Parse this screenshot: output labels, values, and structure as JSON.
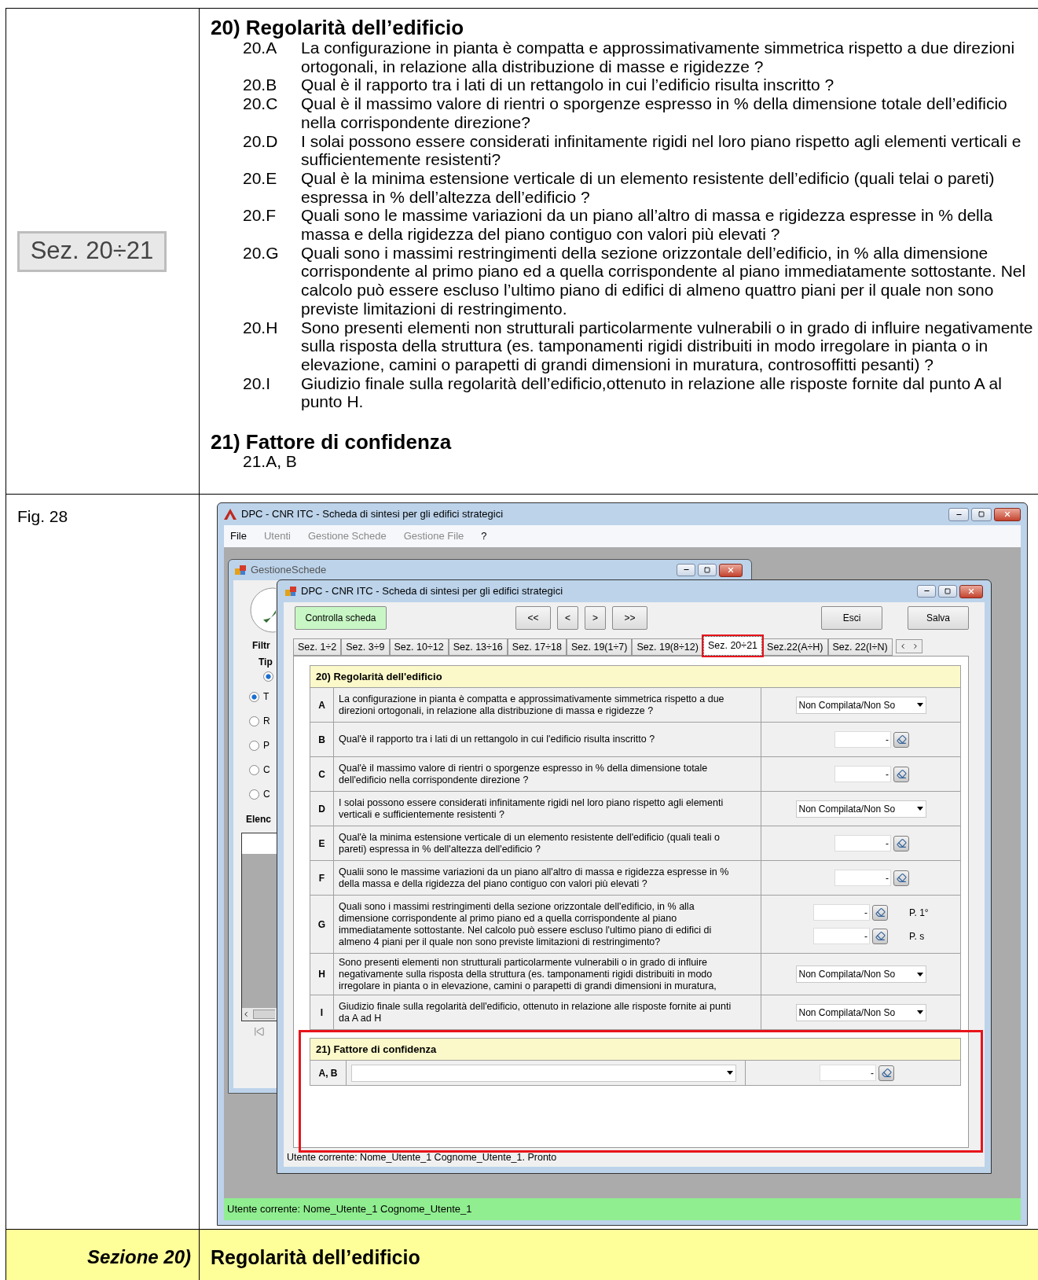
{
  "doc": {
    "top_left_image_label": "Sez. 20÷21",
    "section20": {
      "heading": "20) Regolarità dell’edificio",
      "items": [
        {
          "code": "20.A",
          "text": "La configurazione in pianta è compatta e approssimativamente simmetrica rispetto a due direzioni ortogonali, in relazione alla distribuzione di masse e rigidezze ?"
        },
        {
          "code": "20.B",
          "text": "Qual è il rapporto tra i lati di un rettangolo in cui l’edificio risulta inscritto ?"
        },
        {
          "code": "20.C",
          "text": "Qual è il massimo valore di rientri o sporgenze espresso in % della dimensione totale dell’edificio nella corrispondente direzione?"
        },
        {
          "code": "20.D",
          "text": "I solai possono essere considerati infinitamente rigidi nel loro piano rispetto agli elementi verticali e sufficientemente resistenti?"
        },
        {
          "code": "20.E",
          "text": "Qual è la minima estensione verticale di un elemento resistente dell’edificio (quali telai o pareti) espressa in % dell’altezza dell’edificio ?"
        },
        {
          "code": "20.F",
          "text": "Quali sono le massime variazioni da un piano all’altro di massa e rigidezza espresse in % della massa e della rigidezza del piano contiguo con valori più elevati ?"
        },
        {
          "code": "20.G",
          "text": "Quali sono i massimi restringimenti della sezione orizzontale dell’edificio, in % alla dimensione corrispondente al primo piano ed a quella corrispondente al piano immediatamente sottostante. Nel calcolo può essere escluso l’ultimo piano di edifici di almeno quattro piani per il quale non sono previste limitazioni di restringimento."
        },
        {
          "code": "20.H",
          "text": "Sono presenti elementi non strutturali particolarmente vulnerabili o in grado di influire negativamente sulla risposta della struttura (es. tamponamenti rigidi distribuiti in modo irregolare in pianta o in elevazione, camini o parapetti di grandi dimensioni in muratura, controsoffitti pesanti) ?"
        },
        {
          "code": "20.I",
          "text": "Giudizio finale sulla regolarità dell’edificio,ottenuto in relazione alle risposte fornite dal punto A al punto H."
        }
      ]
    },
    "section21": {
      "heading": "21) Fattore di confidenza",
      "items": [
        "21.A, B"
      ]
    },
    "figure_label": "Fig. 28",
    "footer": {
      "label": "Sezione 20)",
      "title": "Regolarità dell’edificio"
    }
  },
  "app": {
    "title": "DPC - CNR ITC - Scheda di sintesi per gli edifici strategici",
    "menu": [
      {
        "label": "File",
        "disabled": false
      },
      {
        "label": "Utenti",
        "disabled": true
      },
      {
        "label": "Gestione Schede",
        "disabled": true
      },
      {
        "label": "Gestione File",
        "disabled": true
      },
      {
        "label": "?",
        "disabled": false
      }
    ],
    "back_window": {
      "title": "GestioneSchede",
      "filter_label": "Filtr",
      "type_label": "Tip",
      "type_radios": [
        {
          "selected": true
        }
      ],
      "radios": [
        {
          "label": "T",
          "selected": true
        },
        {
          "label": "R",
          "selected": false
        },
        {
          "label": "P",
          "selected": false
        },
        {
          "label": "C",
          "selected": false
        },
        {
          "label": "C",
          "selected": false
        }
      ],
      "list_label": "Elenc"
    },
    "form": {
      "title": "DPC - CNR ITC - Scheda di sintesi per gli edifici strategici",
      "check_button": "Controlla scheda",
      "nav_buttons": [
        "<<",
        "<",
        ">",
        ">>"
      ],
      "exit_button": "Esci",
      "save_button": "Salva",
      "tabs": [
        {
          "label": "Sez. 1÷2",
          "selected": false
        },
        {
          "label": "Sez. 3÷9",
          "selected": false
        },
        {
          "label": "Sez. 10÷12",
          "selected": false
        },
        {
          "label": "Sez. 13÷16",
          "selected": false
        },
        {
          "label": "Sez. 17÷18",
          "selected": false
        },
        {
          "label": "Sez. 19(1÷7)",
          "selected": false
        },
        {
          "label": "Sez. 19(8÷12)",
          "selected": false
        },
        {
          "label": "Sez. 20÷21",
          "selected": true
        },
        {
          "label": "Sez.22(A÷H)",
          "selected": false
        },
        {
          "label": "Sez. 22(I÷N)",
          "selected": false
        }
      ],
      "sections": [
        {
          "title": "20) Regolarità dell'edificio",
          "rows": [
            {
              "letter": "A",
              "kind": "dropdown",
              "text": "La configurazione in pianta è compatta e approssimativamente simmetrica rispetto a due direzioni ortogonali, in relazione alla distribuzione di massa e rigidezze ?",
              "value": "Non Compilata/Non So"
            },
            {
              "letter": "B",
              "kind": "number",
              "text": "Qual'è il rapporto tra i lati di un rettangolo in cui l'edificio risulta inscritto ?",
              "fields": [
                {
                  "value": "-"
                }
              ]
            },
            {
              "letter": "C",
              "kind": "number",
              "text": "Qual'è il massimo valore di rientri o sporgenze espresso in % della dimensione totale dell'edificio nella corrispondente direzione ?",
              "fields": [
                {
                  "value": "-"
                }
              ]
            },
            {
              "letter": "D",
              "kind": "dropdown",
              "text": "I solai possono essere considerati infinitamente rigidi nel loro piano rispetto agli elementi verticali e sufficientemente resistenti ?",
              "value": "Non Compilata/Non So"
            },
            {
              "letter": "E",
              "kind": "number",
              "text": "Qual'è la minima estensione verticale di un elemento resistente dell'edificio (quali teali o pareti) espressa in % dell'altezza dell'edificio ?",
              "fields": [
                {
                  "value": "-"
                }
              ]
            },
            {
              "letter": "F",
              "kind": "number",
              "text": "Qualii sono le massime variazioni da un piano all'altro di massa e rigidezza espresse in % della massa e della rigidezza del piano contiguo con valori più elevati ?",
              "fields": [
                {
                  "value": "-"
                }
              ]
            },
            {
              "letter": "G",
              "kind": "number",
              "text": "Quali sono i massimi restringimenti della sezione orizzontale dell'edificio, in % alla dimensione corrispondente al primo piano ed a quella corrispondente al piano immediatamente sottostante. Nel calcolo può essere escluso l'ultimo piano di edifici di almeno 4 piani per il quale non sono previste limitazioni di restringimento?",
              "fields": [
                {
                  "value": "-",
                  "label": "P. 1°"
                },
                {
                  "value": "-",
                  "label": "P. s"
                }
              ]
            },
            {
              "letter": "H",
              "kind": "dropdown",
              "text": "Sono presenti elementi non strutturali particolarmente vulnerabili o in grado di influire negativamente sulla risposta della struttura (es. tamponamenti rigidi distribuiti in modo irregolare in pianta o in elevazione, camini o parapetti di grandi dimensioni in muratura,",
              "value": "Non Compilata/Non So"
            },
            {
              "letter": "I",
              "kind": "dropdown",
              "text": "Giudizio finale sulla regolarità dell'edificio, ottenuto in relazione alle risposte fornite ai punti da A ad H",
              "value": "Non Compilata/Non So"
            }
          ]
        },
        {
          "title": "21) Fattore di confidenza",
          "highlighted": true,
          "rows": [
            {
              "letter": "A, B",
              "kind": "select_number",
              "fields": [
                {
                  "value": "-"
                }
              ]
            }
          ]
        }
      ],
      "status": "Utente corrente: Nome_Utente_1 Cognome_Utente_1. Pronto"
    },
    "status_bar": "Utente corrente: Nome_Utente_1 Cognome_Utente_1"
  }
}
